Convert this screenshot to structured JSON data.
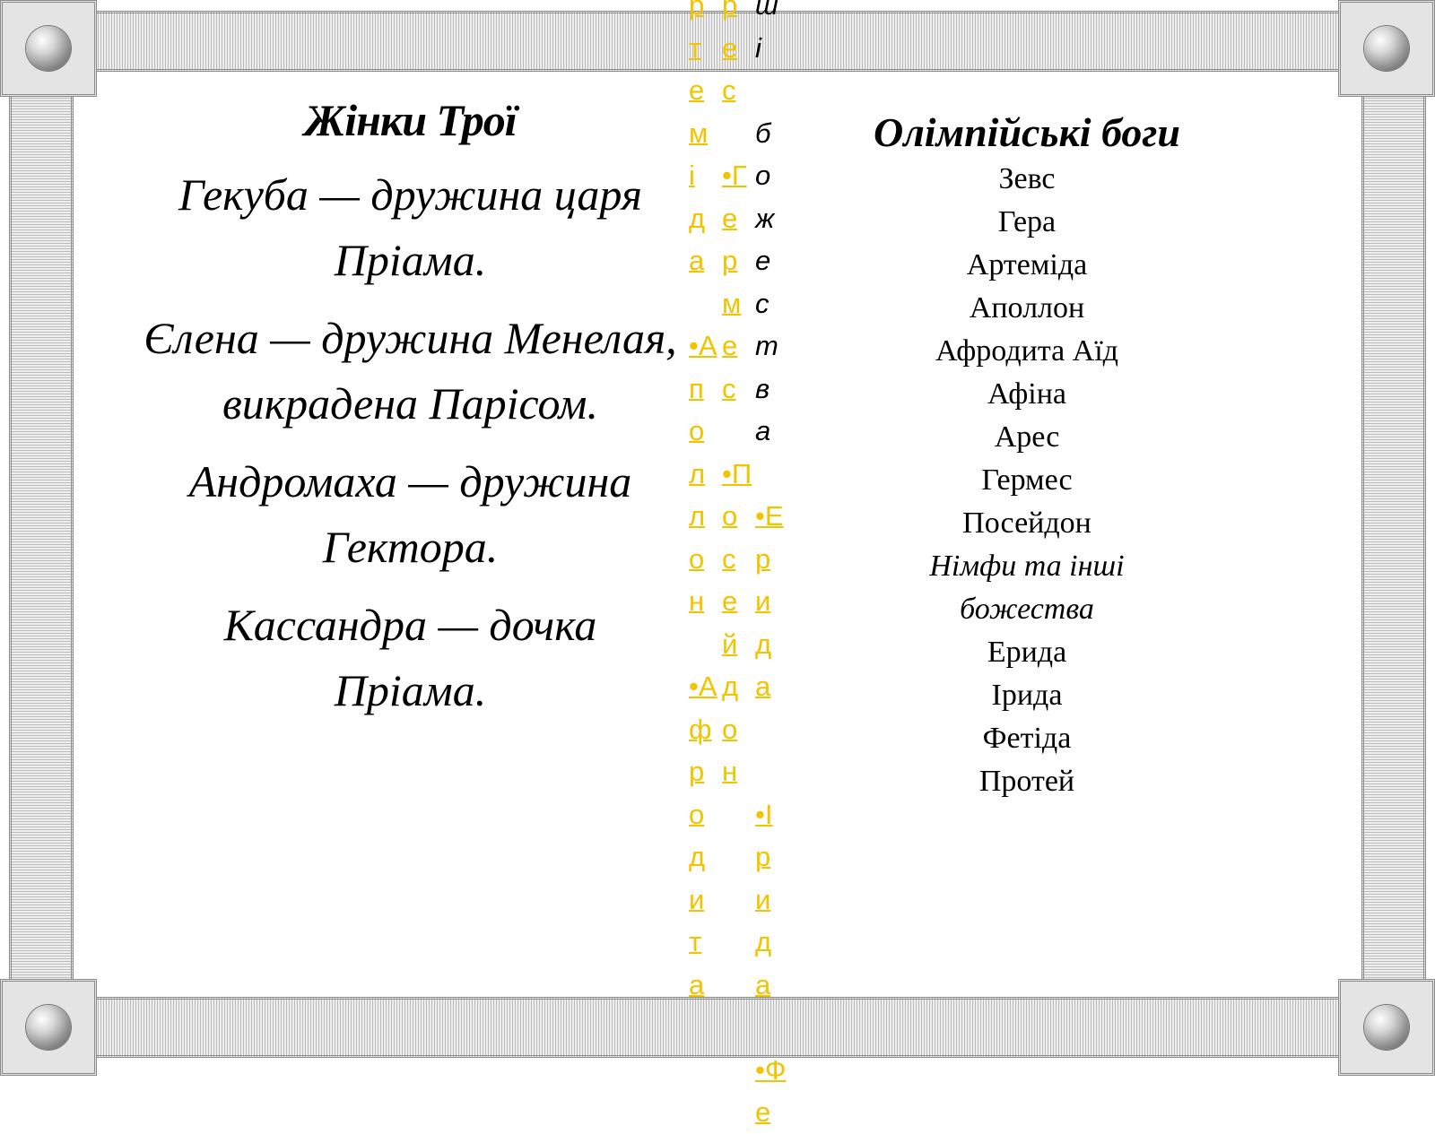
{
  "left": {
    "title": "Жінки Трої",
    "items": [
      "Гекуба — дружина царя Пріама.",
      "Єлена — дружина Менелая, викрадена Парісом.",
      "Андромаха — дружина Гектора.",
      "Кассандра — дочка Пріама."
    ]
  },
  "right": {
    "title": "Олімпійські боги",
    "gods": [
      "Зевс",
      "Гера",
      "Артеміда",
      "Аполлон",
      "Афродита Аїд",
      "Афіна",
      "Арес",
      "Гермес",
      "Посейдон"
    ],
    "others_heading": [
      "Німфи та інші",
      "божества"
    ],
    "others": [
      "Ерида",
      "Ірида",
      "Фетіда",
      "Протей"
    ]
  },
  "overflow_columns": {
    "col1": [
      "р",
      "т",
      "е",
      "м",
      "і",
      "д",
      "а",
      "",
      "•А",
      "п",
      "о",
      "л",
      "л",
      "о",
      "н",
      "",
      "•А",
      "ф",
      "р",
      "о",
      "д",
      "и",
      "т",
      "а"
    ],
    "col2": [
      "р",
      "е",
      "с",
      "",
      "•Г",
      "е",
      "р",
      "м",
      "е",
      "с",
      "",
      "•П",
      "о",
      "с",
      "е",
      "й",
      "д",
      "о",
      "н"
    ],
    "col3": [
      "ш",
      "і",
      "",
      "б",
      "о",
      "ж",
      "е",
      "с",
      "т",
      "в",
      "а",
      "",
      "•Е",
      "р",
      "и",
      "д",
      "а",
      "",
      "",
      "•І",
      "р",
      "и",
      "д",
      "а",
      "",
      "•Ф",
      "е"
    ]
  },
  "colors": {
    "link": "#f2c400",
    "frame": "#bcbcbc"
  }
}
